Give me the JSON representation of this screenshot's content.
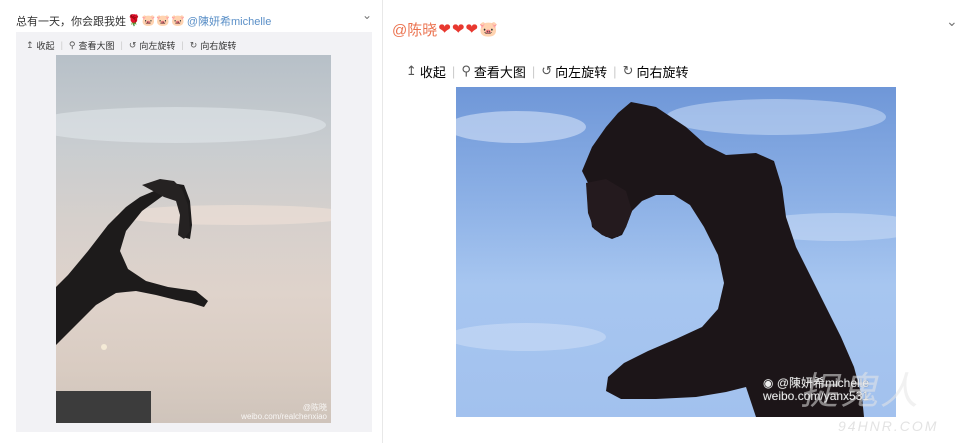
{
  "left_post": {
    "text": "总有一天，你会跟我姓",
    "emoji": [
      "🌹",
      "🐷",
      "🐷",
      "🐷"
    ],
    "mention": "@陳妍希michelle",
    "tools": {
      "collapse": "收起",
      "view_large": "查看大图",
      "rotate_left": "向左旋转",
      "rotate_right": "向右旋转"
    },
    "watermark_line1": "@陈晓",
    "watermark_line2": "weibo.com/realchenxiao"
  },
  "right_post": {
    "mention": "@陈晓",
    "emoji": [
      "❤",
      "❤",
      "❤",
      "🐷"
    ],
    "tools": {
      "collapse": "收起",
      "view_large": "查看大图",
      "rotate_left": "向左旋转",
      "rotate_right": "向右旋转"
    },
    "watermark_line1": "@陳妍希michelle",
    "watermark_line2": "weibo.com/yanx531"
  },
  "site": {
    "mark": "捉鬼人",
    "url": "94HNR.COM"
  },
  "icons": {
    "chevron": "chevron-down-icon",
    "collapse": "arrow-up-icon",
    "view_large": "magnifier-icon",
    "rotate_left": "rotate-left-icon",
    "rotate_right": "rotate-right-icon",
    "weibo": "weibo-logo-icon"
  },
  "colors": {
    "mention": "#eb7350",
    "link_blue": "#5a8fc7",
    "heart": "#e8382f",
    "toolbar_bg": "#f2f2f5"
  }
}
